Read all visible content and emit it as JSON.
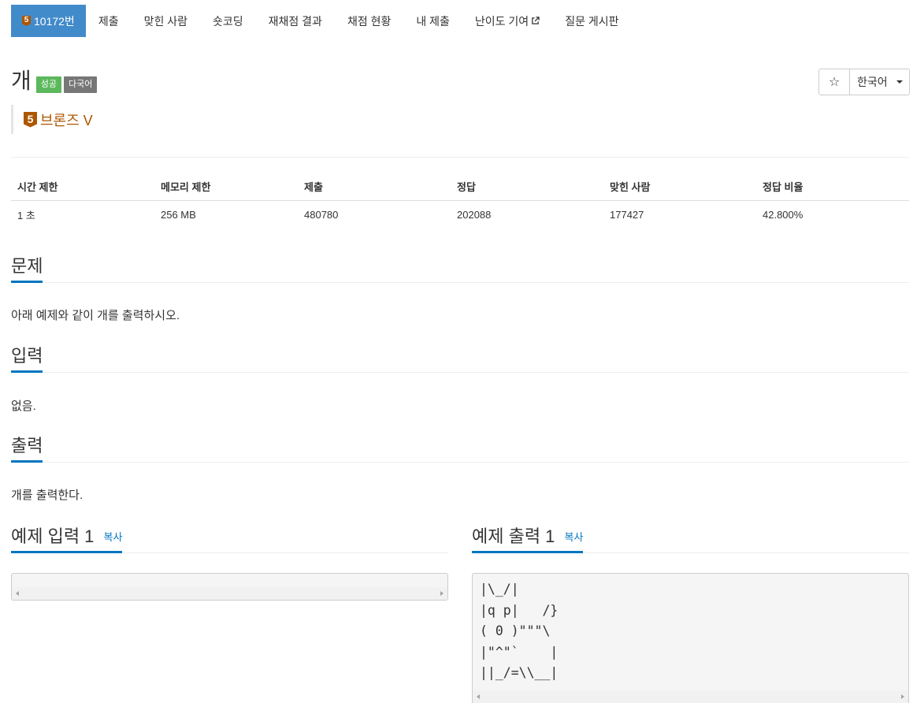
{
  "nav": {
    "problem_tier": "5",
    "items": [
      {
        "label": "10172번"
      },
      {
        "label": "제출"
      },
      {
        "label": "맞힌 사람"
      },
      {
        "label": "숏코딩"
      },
      {
        "label": "재채점 결과"
      },
      {
        "label": "채점 현황"
      },
      {
        "label": "내 제출"
      },
      {
        "label": "난이도 기여"
      },
      {
        "label": "질문 게시판"
      }
    ]
  },
  "problem": {
    "title": "개",
    "labels": {
      "success": "성공",
      "multi": "다국어"
    },
    "tier_number": "5",
    "tier_name": "브론즈 V",
    "tier_color": "#ad5600"
  },
  "toolbar": {
    "star_icon": "☆",
    "language": "한국어"
  },
  "info_table": {
    "headers": [
      "시간 제한",
      "메모리 제한",
      "제출",
      "정답",
      "맞힌 사람",
      "정답 비율"
    ],
    "values": [
      "1 초",
      "256 MB",
      "480780",
      "202088",
      "177427",
      "42.800%"
    ]
  },
  "sections": {
    "description": {
      "title": "문제",
      "text": "아래 예제와 같이 개를 출력하시오."
    },
    "input": {
      "title": "입력",
      "text": "없음."
    },
    "output": {
      "title": "출력",
      "text": "개를 출력한다."
    }
  },
  "samples": {
    "copy_label": "복사",
    "input_title": "예제 입력 1",
    "input_text": "",
    "output_title": "예제 출력 1",
    "output_text": "|\\_/|\n|q p|   /}\n( 0 )\"\"\"\\\n|\"^\"`    |\n||_/=\\\\__|"
  },
  "colors": {
    "primary": "#428bca",
    "accent": "#0076c0",
    "success": "#5cb85c",
    "muted": "#777777"
  }
}
